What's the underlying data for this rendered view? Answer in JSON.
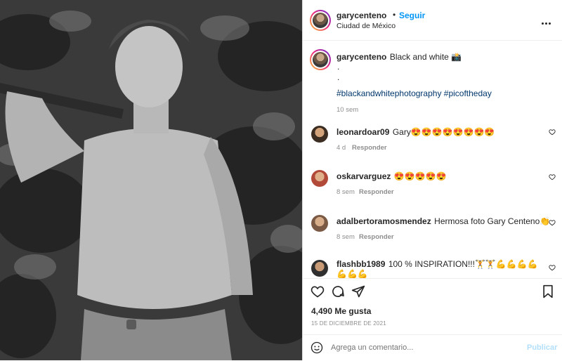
{
  "post": {
    "author": "garycenteno",
    "follow_label": "Seguir",
    "location": "Ciudad de México",
    "caption_title": "Black and white 📸",
    "caption_dots": [
      ".",
      ".",
      "."
    ],
    "hashtags": "#blackandwhitephotography #picoftheday",
    "caption_age": "10 sem",
    "likes": "4,490 Me gusta",
    "date": "15 DE DICIEMBRE DE 2021"
  },
  "comments": [
    {
      "user": "leonardoar09",
      "text": "Gary😍😍😍😍😍😍😍😍",
      "age": "4 d",
      "reply": "Responder"
    },
    {
      "user": "oskarvarguez",
      "text": "😍😍😍😍😍",
      "age": "8 sem",
      "reply": "Responder"
    },
    {
      "user": "adalbertoramosmendez",
      "text": "Hermosa foto Gary Centeno👏",
      "age": "8 sem",
      "reply": "Responder"
    },
    {
      "user": "flashbb1989",
      "text": "100 % INSPIRATION!!!🏋🏋💪💪💪💪💪💪💪",
      "text2": "💪💪💪💪💪💪💪💪💪🔥🔥🔥🔥",
      "age": "",
      "reply": ""
    }
  ],
  "composer": {
    "placeholder": "Agrega un comentario...",
    "publish_label": "Publicar"
  },
  "icons": {
    "like": "heart-icon",
    "comment": "comment-icon",
    "share": "share-icon",
    "save": "bookmark-icon",
    "emoji": "smile-icon",
    "more": "more-icon"
  },
  "colors": {
    "accent": "#0095f6",
    "hashtag": "#00376b",
    "muted": "#8e8e8e"
  }
}
